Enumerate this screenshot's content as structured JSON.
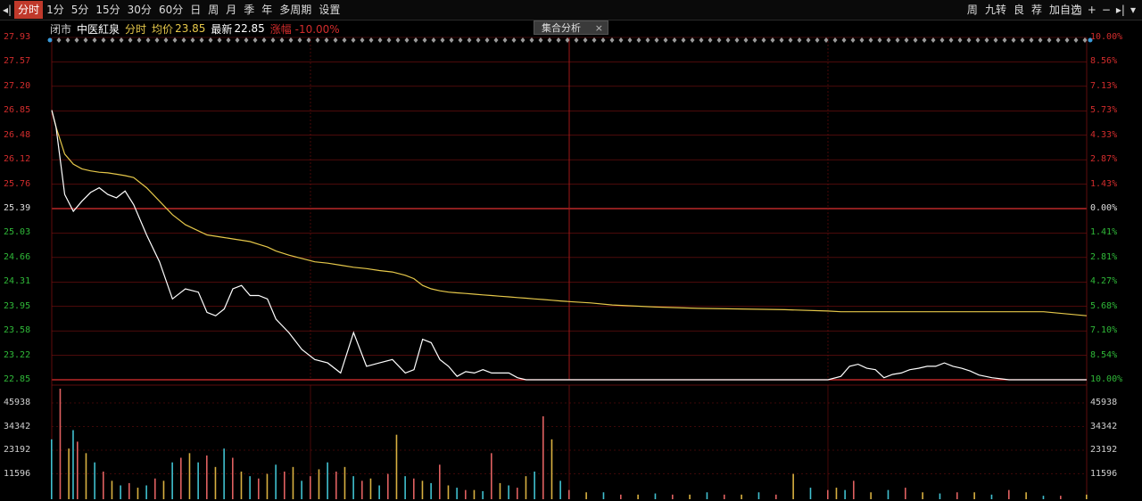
{
  "toolbar": {
    "left_arrow_glyph": "◂|",
    "periods": [
      "分时",
      "1分",
      "5分",
      "15分",
      "30分",
      "60分",
      "日",
      "周",
      "月",
      "季",
      "年",
      "多周期",
      "设置"
    ],
    "active_period_index": 0,
    "right_buttons": [
      "周",
      "九转",
      "良",
      "荐",
      "加自选"
    ],
    "right_icons": [
      "□",
      "+",
      "−",
      "▸|",
      "▾"
    ]
  },
  "infobar": {
    "market": "闭市",
    "stock_name": "中医紅泉",
    "mode": "分时",
    "avg_label": "均价",
    "avg_value": "23.85",
    "latest_label": "最新",
    "latest_value": "22.85",
    "change_text": "涨幅 -10.00%"
  },
  "popup": {
    "label": "集合分析",
    "close": "×"
  },
  "colors": {
    "price_line": "#ffffff",
    "avg_line": "#e6c84a",
    "grid": "#7a1010",
    "base_line": "#e03030",
    "up": "#d22c2c",
    "down": "#2fb838",
    "vol_up": "#e06060",
    "vol_down": "#40c0d0",
    "vol_yellow": "#d8b040"
  },
  "axis": {
    "left_up": [
      "27.93",
      "27.57",
      "27.20",
      "26.85",
      "26.48",
      "26.12",
      "25.76"
    ],
    "left_base": "25.39",
    "left_down": [
      "25.03",
      "24.66",
      "24.31",
      "23.95",
      "23.58",
      "23.22",
      "22.85"
    ],
    "right_up": [
      "10.00%",
      "8.56%",
      "7.13%",
      "5.73%",
      "4.33%",
      "2.87%",
      "1.43%"
    ],
    "right_base": "0.00%",
    "right_down": [
      "1.41%",
      "2.81%",
      "4.27%",
      "5.68%",
      "7.10%",
      "8.54%",
      "10.00%"
    ],
    "volume_ticks": [
      "45938",
      "34342",
      "23192",
      "11596"
    ]
  },
  "chart_data": {
    "type": "line",
    "prev_close": 25.39,
    "ylim": [
      22.85,
      27.93
    ],
    "x": [
      0,
      1,
      3,
      5,
      7,
      9,
      11,
      13,
      15,
      17,
      19,
      22,
      25,
      28,
      31,
      34,
      36,
      38,
      40,
      42,
      44,
      46,
      48,
      50,
      52,
      55,
      58,
      61,
      64,
      67,
      70,
      73,
      76,
      79,
      82,
      84,
      86,
      88,
      90,
      92,
      94,
      96,
      98,
      100,
      102,
      104,
      106,
      108,
      110,
      112,
      114,
      116,
      118,
      120,
      125,
      130,
      140,
      150,
      160,
      170,
      180,
      183,
      185,
      187,
      189,
      191,
      193,
      195,
      197,
      199,
      201,
      203,
      205,
      207,
      209,
      211,
      213,
      215,
      218,
      222,
      226,
      230,
      240
    ],
    "series": [
      {
        "values": [
          26.85,
          26.6,
          25.6,
          25.35,
          25.5,
          25.63,
          25.7,
          25.6,
          25.55,
          25.65,
          25.45,
          25.0,
          24.6,
          24.05,
          24.2,
          24.15,
          23.85,
          23.8,
          23.9,
          24.2,
          24.25,
          24.1,
          24.1,
          24.05,
          23.75,
          23.55,
          23.3,
          23.15,
          23.1,
          22.95,
          23.55,
          23.05,
          23.1,
          23.15,
          22.95,
          23.0,
          23.45,
          23.4,
          23.15,
          23.05,
          22.9,
          22.97,
          22.95,
          23.0,
          22.95,
          22.95,
          22.95,
          22.88,
          22.85,
          22.85,
          22.85,
          22.85,
          22.85,
          22.85,
          22.85,
          22.85,
          22.85,
          22.85,
          22.85,
          22.85,
          22.85,
          22.9,
          23.05,
          23.08,
          23.02,
          23.0,
          22.88,
          22.93,
          22.95,
          23.0,
          23.02,
          23.05,
          23.05,
          23.1,
          23.05,
          23.02,
          22.98,
          22.92,
          22.88,
          22.85,
          22.85,
          22.85,
          22.85
        ]
      },
      {
        "values": [
          26.85,
          26.6,
          26.2,
          26.05,
          25.98,
          25.95,
          25.93,
          25.92,
          25.9,
          25.88,
          25.85,
          25.7,
          25.5,
          25.3,
          25.15,
          25.06,
          25.0,
          24.98,
          24.96,
          24.94,
          24.92,
          24.9,
          24.86,
          24.82,
          24.76,
          24.7,
          24.65,
          24.6,
          24.58,
          24.55,
          24.52,
          24.5,
          24.47,
          24.45,
          24.4,
          24.35,
          24.25,
          24.2,
          24.17,
          24.15,
          24.14,
          24.13,
          24.12,
          24.11,
          24.1,
          24.09,
          24.08,
          24.07,
          24.06,
          24.05,
          24.04,
          24.03,
          24.02,
          24.01,
          23.99,
          23.96,
          23.93,
          23.91,
          23.9,
          23.89,
          23.87,
          23.86,
          23.86,
          23.86,
          23.86,
          23.86,
          23.86,
          23.86,
          23.86,
          23.86,
          23.86,
          23.86,
          23.86,
          23.86,
          23.86,
          23.86,
          23.86,
          23.86,
          23.86,
          23.86,
          23.86,
          23.86,
          23.8
        ]
      }
    ],
    "volume": {
      "x": [
        0,
        2,
        4,
        5,
        6,
        8,
        10,
        12,
        14,
        16,
        18,
        20,
        22,
        24,
        26,
        28,
        30,
        32,
        34,
        36,
        38,
        40,
        42,
        44,
        46,
        48,
        50,
        52,
        54,
        56,
        58,
        60,
        62,
        64,
        66,
        68,
        70,
        72,
        74,
        76,
        78,
        80,
        82,
        84,
        86,
        88,
        90,
        92,
        94,
        96,
        98,
        100,
        102,
        104,
        106,
        108,
        110,
        112,
        114,
        116,
        118,
        120,
        124,
        128,
        132,
        136,
        140,
        144,
        148,
        152,
        156,
        160,
        164,
        168,
        172,
        176,
        180,
        182,
        184,
        186,
        190,
        194,
        198,
        202,
        206,
        210,
        214,
        218,
        222,
        226,
        230,
        234,
        240
      ],
      "values": [
        26000,
        48000,
        22000,
        30000,
        25000,
        20000,
        16000,
        12000,
        8000,
        6000,
        7000,
        5000,
        6000,
        9000,
        8000,
        16000,
        18000,
        20000,
        16000,
        19000,
        14000,
        22000,
        18000,
        12000,
        10000,
        9000,
        11000,
        15000,
        12000,
        14000,
        8000,
        10000,
        13000,
        16000,
        12000,
        14000,
        10000,
        8000,
        9000,
        6000,
        11000,
        28000,
        10000,
        9000,
        8000,
        7000,
        15000,
        6000,
        5000,
        4000,
        4000,
        3500,
        20000,
        7000,
        6000,
        5000,
        10000,
        12000,
        36000,
        26000,
        8000,
        4000,
        3000,
        3000,
        2000,
        2000,
        2500,
        2000,
        2000,
        3000,
        2000,
        2000,
        3000,
        2000,
        11000,
        5000,
        4000,
        5000,
        4000,
        8000,
        3000,
        4000,
        5000,
        3000,
        2500,
        3000,
        3000,
        2000,
        4000,
        3000,
        1500,
        1500,
        2000
      ]
    }
  }
}
